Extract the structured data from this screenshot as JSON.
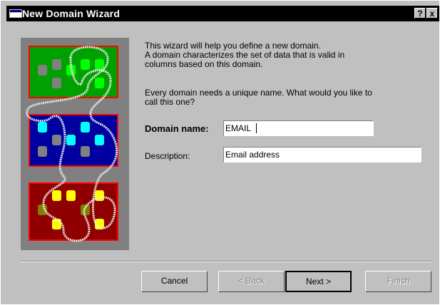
{
  "window": {
    "title": "New Domain Wizard"
  },
  "titlebar_buttons": {
    "help": "?",
    "close": "x"
  },
  "intro_lines": "This wizard will help you define a new domain.\nA domain characterizes the set of data that is valid in\ncolumns based on this domain.",
  "name_prompt": "Every domain needs a unique name. What would you like to\ncall this one?",
  "fields": {
    "domain_name": {
      "label": "Domain name:",
      "value": "EMAIL"
    },
    "description": {
      "label": "Description:",
      "value": "Email address"
    }
  },
  "buttons": {
    "cancel": "Cancel",
    "back": "< Back",
    "next": "Next >",
    "finish": "Finish"
  },
  "icons": {
    "app": "window-icon",
    "illustration": "domain-boxes-illustration"
  },
  "colors": {
    "title_bar": "#000000",
    "face": "#c0c0c0",
    "illus_green": "#00a000",
    "illus_blue": "#0000a0",
    "illus_red": "#900000"
  }
}
